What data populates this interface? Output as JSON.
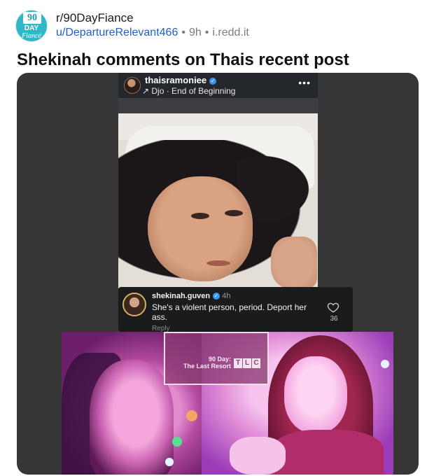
{
  "post": {
    "subreddit": "r/90DayFiance",
    "subreddit_icon": {
      "line1": "90",
      "line2": "DAY",
      "line3": "Fiancé"
    },
    "author": "u/DepartureRelevant466",
    "age": "9h",
    "domain": "i.redd.it",
    "separator": "•",
    "title": "Shekinah comments on Thais recent post"
  },
  "story": {
    "username": "thaisramoniee",
    "verified": true,
    "song": "↗ Djo · End of Beginning",
    "more_icon": "•••"
  },
  "comment": {
    "username": "shekinah.guven",
    "time": "4h",
    "text": "She's a violent person, period. Deport her ass.",
    "reply": "Reply",
    "likes": "36",
    "heart_icon": "heart-outline-icon"
  },
  "tv_logo": {
    "show_line1": "90 Day:",
    "show_line2": "The Last Resort",
    "network_letters": [
      "T",
      "L",
      "C"
    ]
  },
  "colors": {
    "accent_link": "#1f5fc7",
    "meta_gray": "#7c7c83",
    "card_background": "#363636",
    "subreddit_icon_bg": "#2fb9c6"
  }
}
